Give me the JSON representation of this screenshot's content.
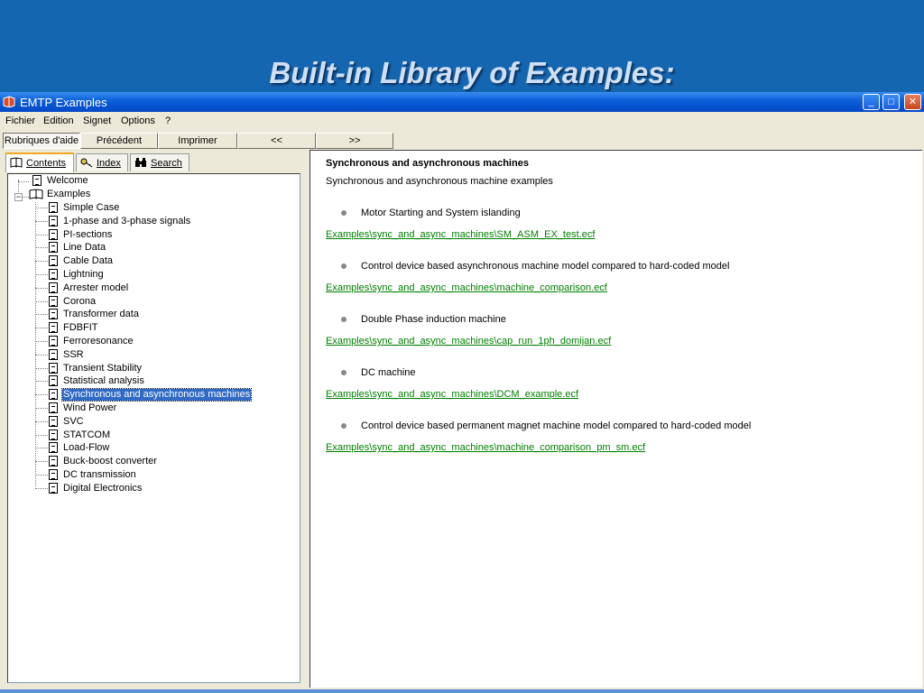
{
  "slide": {
    "title": "Built-in Library of Examples:"
  },
  "window": {
    "title": "EMTP Examples",
    "controls": {
      "minimize": "_",
      "maximize": "□",
      "close": "✕"
    }
  },
  "menu": [
    {
      "label": "Fichier"
    },
    {
      "label": "Edition"
    },
    {
      "label": "Signet"
    },
    {
      "label": "Options"
    },
    {
      "label": "?"
    }
  ],
  "help_buttons": [
    {
      "label": "Rubriques d'aide"
    },
    {
      "label": "Précédent"
    },
    {
      "label": "Imprimer"
    },
    {
      "label": "<<"
    },
    {
      "label": ">>"
    }
  ],
  "tabs": [
    {
      "label": "Contents",
      "icon": "book-icon"
    },
    {
      "label": "Index",
      "icon": "index-key-icon"
    },
    {
      "label": "Search",
      "icon": "binoculars-icon"
    }
  ],
  "tree": {
    "welcome": "Welcome",
    "examples": "Examples",
    "expander": "−",
    "items": [
      "Simple Case",
      "1-phase and 3-phase signals",
      "PI-sections",
      "Line Data",
      "Cable Data",
      "Lightning",
      "Arrester model",
      "Corona",
      "Transformer data",
      "FDBFIT",
      "Ferroresonance",
      "SSR",
      "Transient Stability",
      "Statistical analysis",
      "Synchronous and asynchronous machines",
      "Wind Power",
      "SVC",
      "STATCOM",
      "Load-Flow",
      "Buck-boost converter",
      "DC transmission",
      "Digital Electronics"
    ],
    "selected_index": 14
  },
  "content": {
    "heading": "Synchronous and asynchronous machines",
    "subheading": "Synchronous and asynchronous machine examples",
    "entries": [
      {
        "bullet": "Motor Starting and System islanding",
        "link": "Examples\\sync_and_async_machines\\SM_ASM_EX_test.ecf"
      },
      {
        "bullet": "Control device based asynchronous machine model compared to hard-coded model",
        "link": "Examples\\sync_and_async_machines\\machine_comparison.ecf"
      },
      {
        "bullet": "Double Phase induction machine",
        "link": "Examples\\sync_and_async_machines\\cap_run_1ph_domijan.ecf"
      },
      {
        "bullet": "DC machine",
        "link": "Examples\\sync_and_async_machines\\DCM_example.ecf"
      },
      {
        "bullet": "Control device based permanent magnet machine model compared to hard-coded model",
        "link": "Examples\\sync_and_async_machines\\machine_comparison_pm_sm.ecf"
      }
    ]
  },
  "colors": {
    "slide_background": "#1566b0",
    "titlebar": "#0a5fd8",
    "link": "#008000",
    "selection": "#316ac5"
  }
}
